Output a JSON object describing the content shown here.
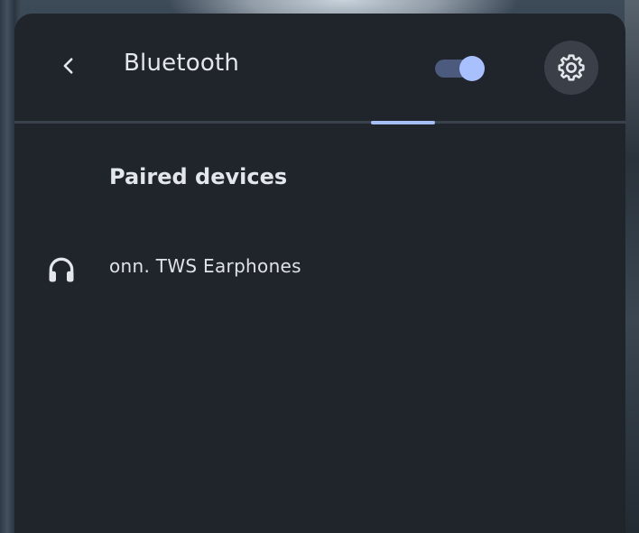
{
  "header": {
    "back_icon": "chevron-left-icon",
    "title": "Bluetooth",
    "bluetooth_enabled": true,
    "settings_icon": "gear-icon"
  },
  "paired_devices": {
    "heading": "Paired devices",
    "devices": [
      {
        "name": "onn. TWS Earphones",
        "icon": "headphones-icon"
      }
    ]
  },
  "colors": {
    "panel_background": "#20242b",
    "accent": "#a9c0ff",
    "toggle_track": "#4c5a7d",
    "text_primary": "#e3e6ea"
  }
}
